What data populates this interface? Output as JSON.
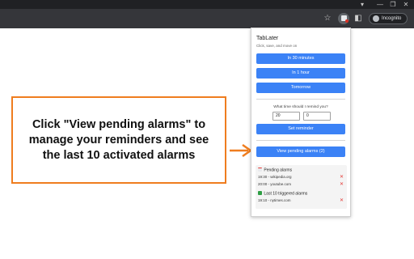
{
  "browser": {
    "incognito_label": "Incognito",
    "window_controls": [
      "▾",
      "—",
      "❐",
      "✕"
    ]
  },
  "callout": {
    "text": "Click \"View pending alarms\" to manage your reminders and see the last 10 activated alarms",
    "border_color": "#ef7d1f"
  },
  "popup": {
    "title": "TabLater",
    "subtitle": "Click, save, and move on",
    "quick_buttons": [
      "In 30 minutes",
      "In 1 hour",
      "Tomorrow"
    ],
    "question": "What time should I remind you?",
    "hour_value": "20",
    "minute_value": "0",
    "set_reminder_label": "Set reminder",
    "view_pending_label": "View pending alarms (2)",
    "pending_title": "Pending alarms",
    "pending": [
      {
        "time": "19:30",
        "site": "wikipedia.org"
      },
      {
        "time": "20:00",
        "site": "youtube.com"
      }
    ],
    "triggered_title": "Last 10 triggered alarms",
    "triggered": [
      {
        "time": "19:10",
        "site": "nytimes.com"
      }
    ],
    "accent_color": "#3b82f6",
    "delete_color": "#e53935"
  }
}
